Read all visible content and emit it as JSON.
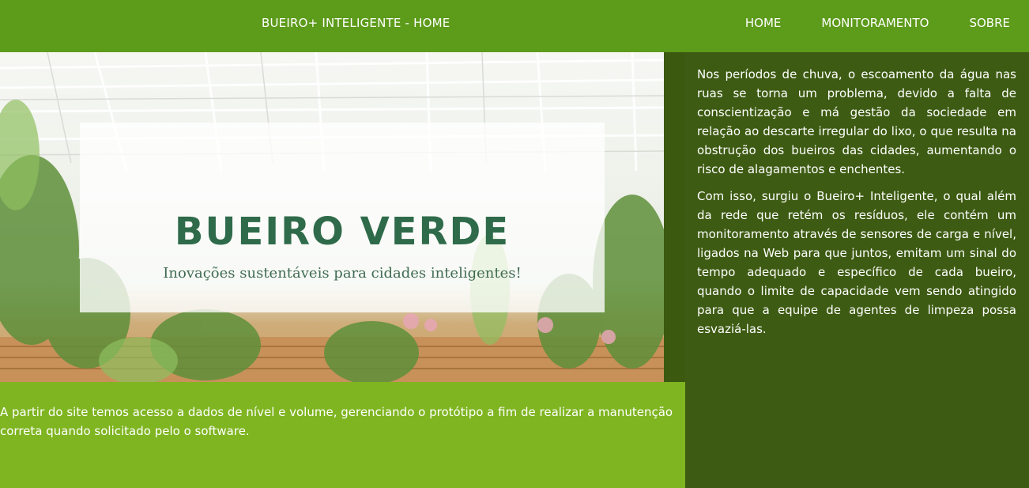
{
  "header": {
    "title": "BUEIRO+ INTELIGENTE - HOME",
    "nav": [
      "HOME",
      "MONITORAMENTO",
      "SOBRE"
    ]
  },
  "hero": {
    "title": "BUEIRO VERDE",
    "subtitle": "Inovações sustentáveis para cidades inteligentes!"
  },
  "info": {
    "text": "A partir do site temos acesso a dados de nível e volume, gerenciando o protótipo a fim de realizar a manutenção correta quando solicitado pelo o software."
  },
  "sidebar": {
    "paragraphs": [
      "Nos períodos de chuva, o escoamento da água nas ruas se torna um problema, devido a falta de conscientização e má gestão da sociedade em relação ao descarte irregular do lixo, o que resulta na obstrução dos bueiros das cidades, aumentando o risco de alagamentos e enchentes.",
      "Com isso, surgiu o Bueiro+ Inteligente, o qual além da rede que retém os resíduos, ele contém um monitoramento através de sensores de carga e nível, ligados na Web para que juntos, emitam um sinal do tempo adequado e específico de cada bueiro, quando o limite de capacidade vem sendo atingido para que a equipe de agentes de limpeza possa esvaziá-las."
    ]
  },
  "colors": {
    "header_bg": "#5d9b1a",
    "info_bg": "#7fb521",
    "sidebar_bg": "#3d5b12",
    "hero_title": "#2f6b4a"
  }
}
